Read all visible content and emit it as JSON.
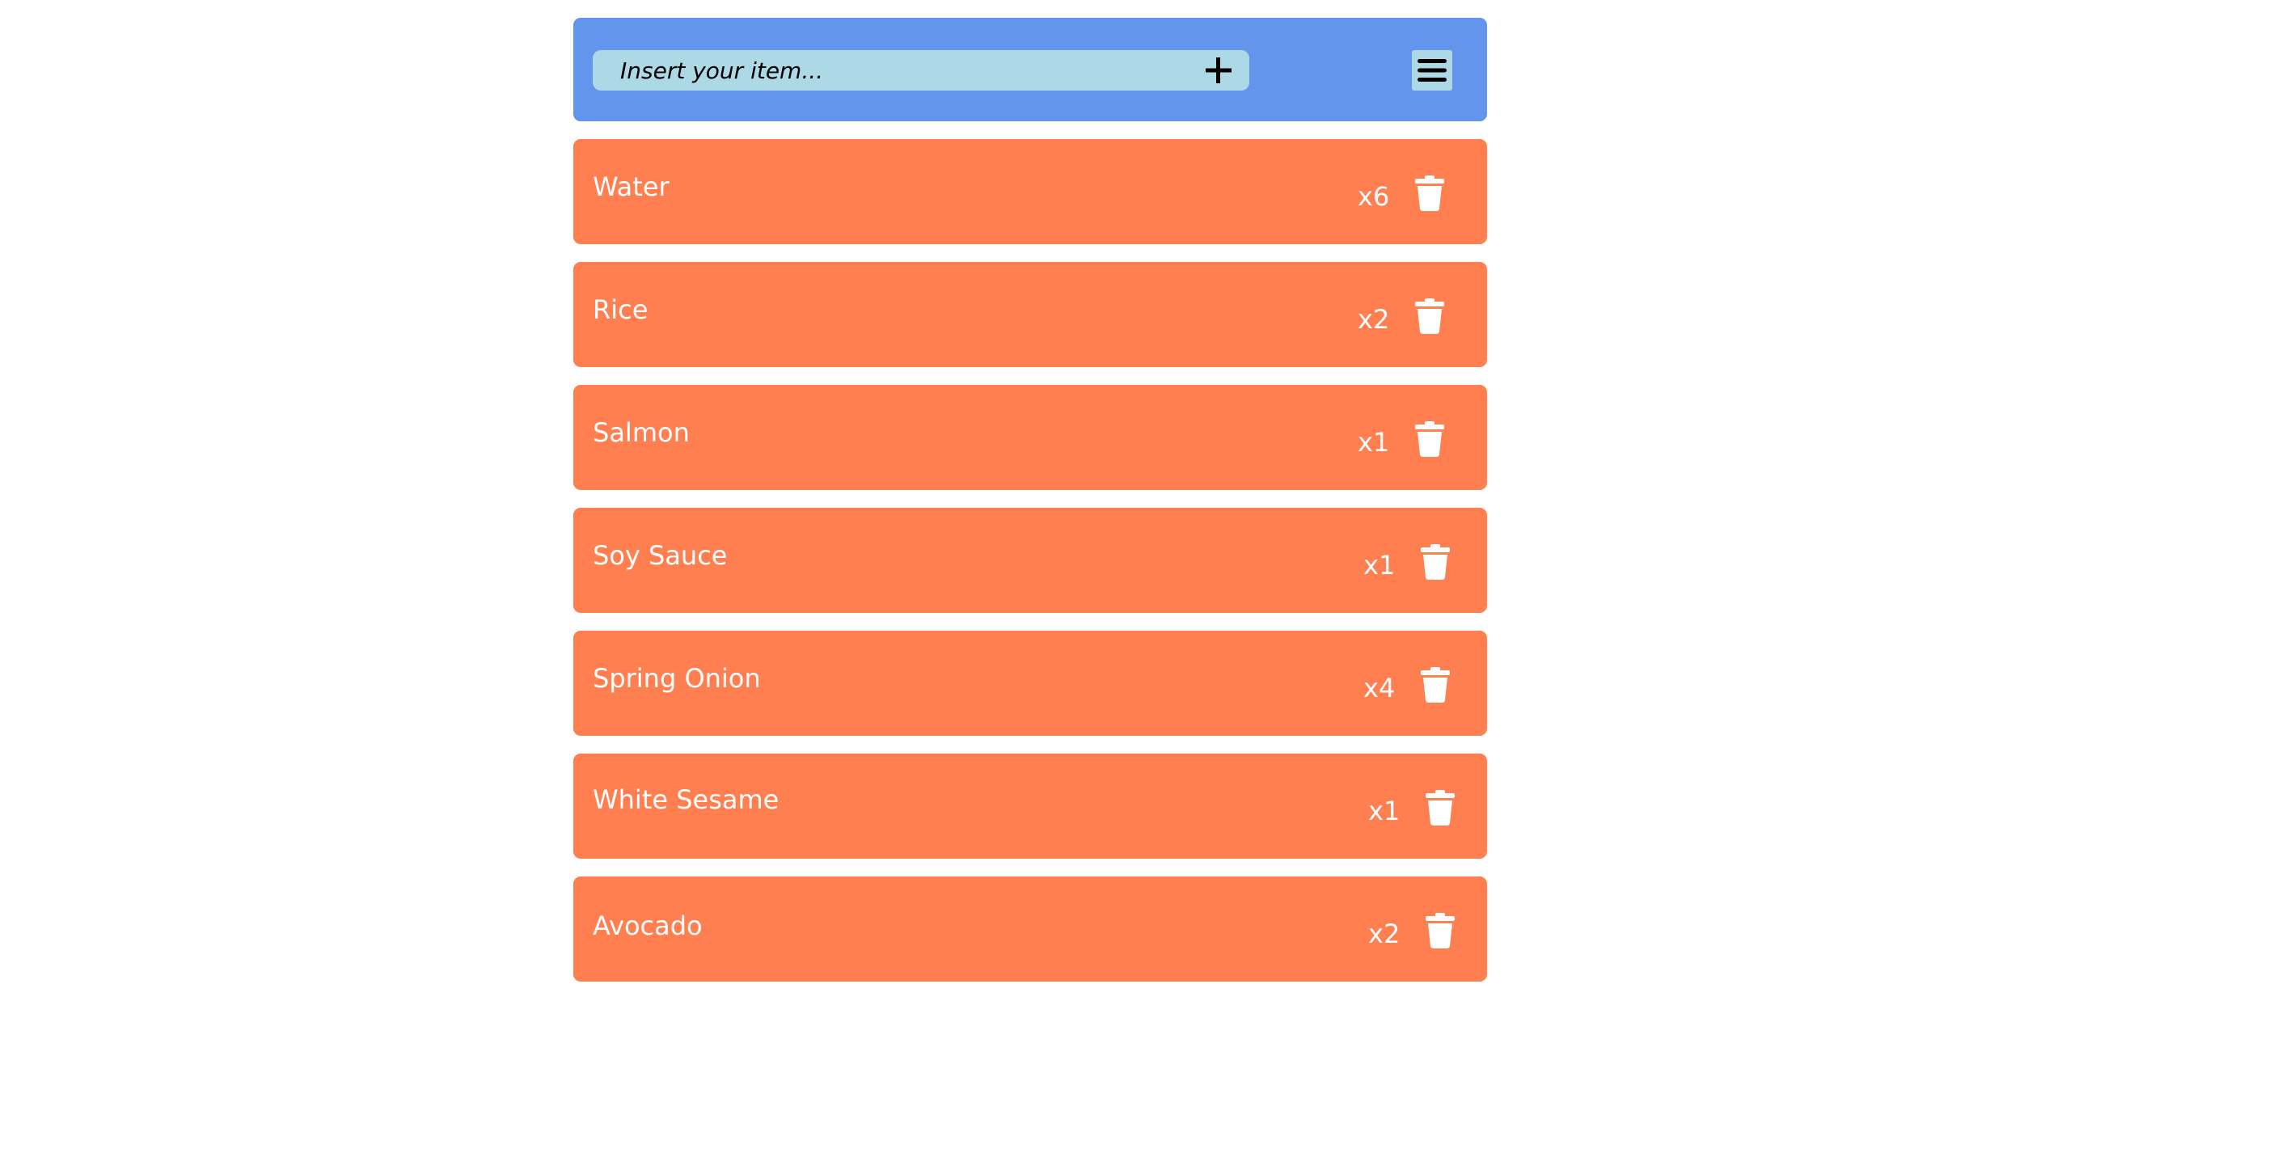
{
  "colors": {
    "header_bg": "#6495ED",
    "search_bg": "#ADD8E6",
    "item_bg": "#FF7F50",
    "item_text": "#FFFFFF",
    "icon_dark": "#000000"
  },
  "header": {
    "input_placeholder": "Insert your item...",
    "input_value": "",
    "add_icon": "plus-icon",
    "menu_icon": "hamburger-menu-icon"
  },
  "items": [
    {
      "name": "Water",
      "qty": "x6",
      "delete_icon": "trash-icon"
    },
    {
      "name": "Rice",
      "qty": "x2",
      "delete_icon": "trash-icon"
    },
    {
      "name": "Salmon",
      "qty": "x1",
      "delete_icon": "trash-icon"
    },
    {
      "name": "Soy Sauce",
      "qty": "x1",
      "delete_icon": "trash-icon"
    },
    {
      "name": "Spring Onion",
      "qty": "x4",
      "delete_icon": "trash-icon"
    },
    {
      "name": "White Sesame",
      "qty": "x1",
      "delete_icon": "trash-icon"
    },
    {
      "name": "Avocado",
      "qty": "x2",
      "delete_icon": "trash-icon"
    }
  ]
}
